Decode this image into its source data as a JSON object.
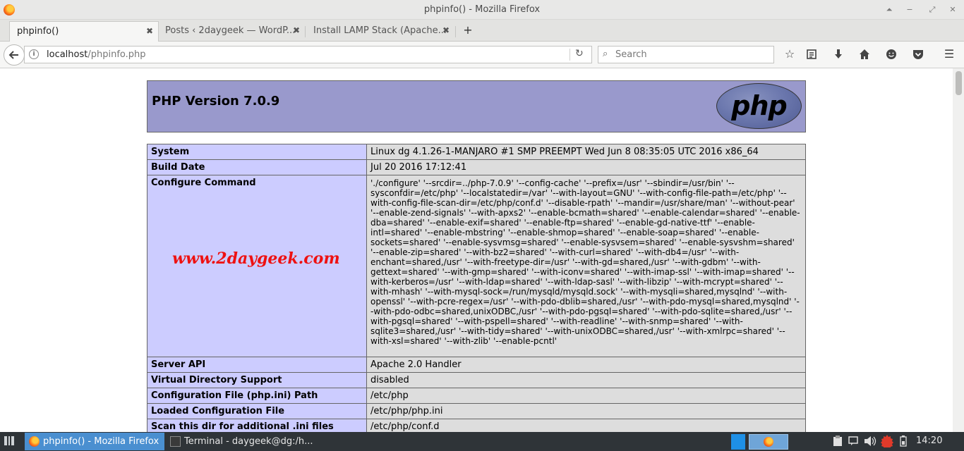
{
  "window": {
    "title": "phpinfo() - Mozilla Firefox",
    "controls": [
      "⏶",
      "−",
      "⤢",
      "✕"
    ]
  },
  "tabs": [
    {
      "label": "phpinfo()",
      "active": true
    },
    {
      "label": "Posts ‹ 2daygeek — WordP...",
      "active": false
    },
    {
      "label": "Install LAMP Stack (Apache...",
      "active": false
    }
  ],
  "navbar": {
    "url_host": "localhost",
    "url_path": "/phpinfo.php",
    "search_placeholder": "Search"
  },
  "page": {
    "php_version": "PHP Version 7.0.9",
    "logo_text": "php",
    "watermark": "www.2daygeek.com",
    "rows": [
      {
        "key": "System",
        "value": "Linux dg 4.1.26-1-MANJARO #1 SMP PREEMPT Wed Jun 8 08:35:05 UTC 2016 x86_64"
      },
      {
        "key": "Build Date",
        "value": "Jul 20 2016 17:12:41"
      },
      {
        "key": "Configure Command",
        "value": "'./configure' '--srcdir=../php-7.0.9' '--config-cache' '--prefix=/usr' '--sbindir=/usr/bin' '--sysconfdir=/etc/php' '--localstatedir=/var' '--with-layout=GNU' '--with-config-file-path=/etc/php' '--with-config-file-scan-dir=/etc/php/conf.d' '--disable-rpath' '--mandir=/usr/share/man' '--without-pear' '--enable-zend-signals' '--with-apxs2' '--enable-bcmath=shared' '--enable-calendar=shared' '--enable-dba=shared' '--enable-exif=shared' '--enable-ftp=shared' '--enable-gd-native-ttf' '--enable-intl=shared' '--enable-mbstring' '--enable-shmop=shared' '--enable-soap=shared' '--enable-sockets=shared' '--enable-sysvmsg=shared' '--enable-sysvsem=shared' '--enable-sysvshm=shared' '--enable-zip=shared' '--with-bz2=shared' '--with-curl=shared' '--with-db4=/usr' '--with-enchant=shared,/usr' '--with-freetype-dir=/usr' '--with-gd=shared,/usr' '--with-gdbm' '--with-gettext=shared' '--with-gmp=shared' '--with-iconv=shared' '--with-imap-ssl' '--with-imap=shared' '--with-kerberos=/usr' '--with-ldap=shared' '--with-ldap-sasl' '--with-libzip' '--with-mcrypt=shared' '--with-mhash' '--with-mysql-sock=/run/mysqld/mysqld.sock' '--with-mysqli=shared,mysqlnd' '--with-openssl' '--with-pcre-regex=/usr' '--with-pdo-dblib=shared,/usr' '--with-pdo-mysql=shared,mysqlnd' '--with-pdo-odbc=shared,unixODBC,/usr' '--with-pdo-pgsql=shared' '--with-pdo-sqlite=shared,/usr' '--with-pgsql=shared' '--with-pspell=shared' '--with-readline' '--with-snmp=shared' '--with-sqlite3=shared,/usr' '--with-tidy=shared' '--with-unixODBC=shared,/usr' '--with-xmlrpc=shared' '--with-xsl=shared' '--with-zlib' '--enable-pcntl'"
      },
      {
        "key": "Server API",
        "value": "Apache 2.0 Handler"
      },
      {
        "key": "Virtual Directory Support",
        "value": "disabled"
      },
      {
        "key": "Configuration File (php.ini) Path",
        "value": "/etc/php"
      },
      {
        "key": "Loaded Configuration File",
        "value": "/etc/php/php.ini"
      },
      {
        "key": "Scan this dir for additional .ini files",
        "value": "/etc/php/conf.d"
      }
    ]
  },
  "taskbar": {
    "items": [
      {
        "label": "phpinfo() - Mozilla Firefox",
        "active": true
      },
      {
        "label": "Terminal - daygeek@dg:/h...",
        "active": false
      }
    ],
    "clock": "14:20"
  },
  "colors": {
    "php_header": "#9999cc",
    "key_cell": "#ccccff",
    "value_cell": "#dddddd",
    "watermark": "#ee1111",
    "taskbar": "#2f3438",
    "taskbar_active": "#4a8fd0"
  }
}
